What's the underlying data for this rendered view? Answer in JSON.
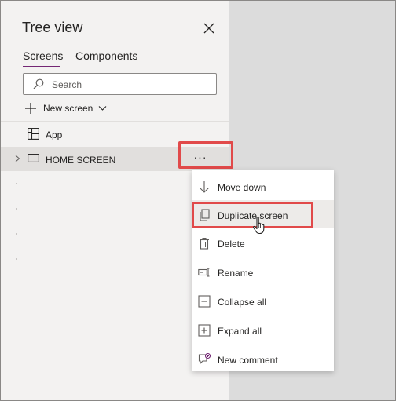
{
  "panel": {
    "title": "Tree view",
    "tabs": [
      {
        "label": "Screens",
        "active": true
      },
      {
        "label": "Components",
        "active": false
      }
    ],
    "search": {
      "placeholder": "Search",
      "value": ""
    },
    "new_screen_label": "New screen"
  },
  "tree": {
    "app_label": "App",
    "screen_label": "HOME SCREEN",
    "more_label": "···"
  },
  "context_menu": {
    "items": [
      {
        "label": "Move down",
        "icon": "arrow-down-icon"
      },
      {
        "label": "Duplicate screen",
        "icon": "duplicate-icon"
      },
      {
        "label": "Delete",
        "icon": "trash-icon"
      },
      {
        "label": "Rename",
        "icon": "rename-icon"
      },
      {
        "label": "Collapse all",
        "icon": "collapse-icon"
      },
      {
        "label": "Expand all",
        "icon": "expand-icon"
      },
      {
        "label": "New comment",
        "icon": "comment-icon"
      }
    ],
    "hovered_item": "Duplicate screen"
  },
  "colors": {
    "accent": "#742774",
    "highlight_border": "#e14a4a",
    "panel_bg": "#f3f2f1",
    "canvas_bg": "#dcdcdc",
    "selected_row_bg": "#e1dfdd"
  }
}
